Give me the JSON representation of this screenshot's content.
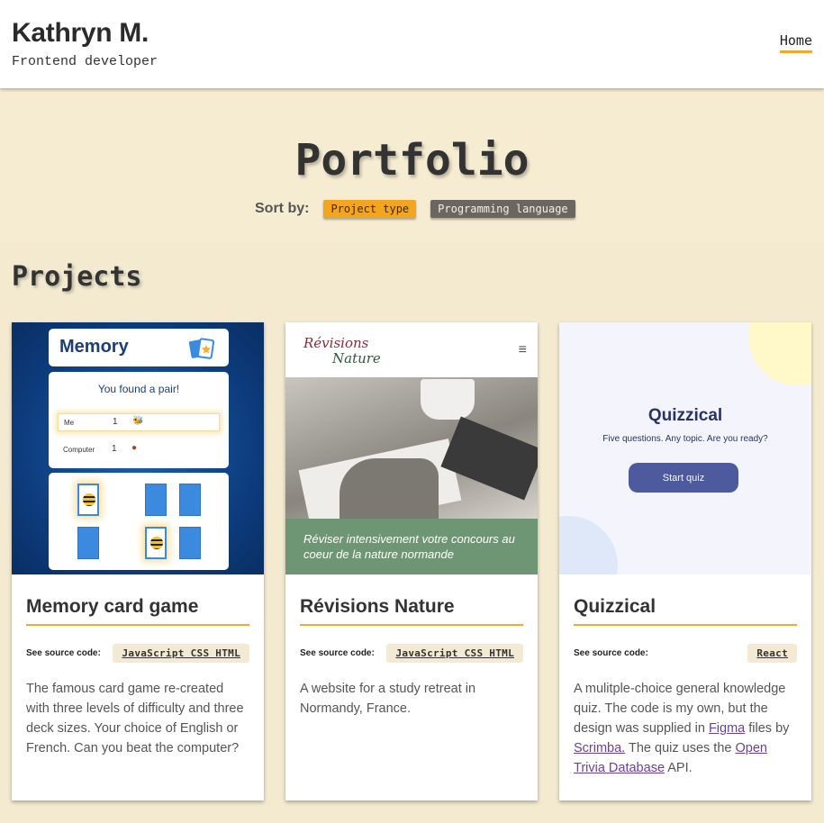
{
  "header": {
    "name": "Kathryn M.",
    "tagline": "Frontend developer",
    "nav_home": "Home"
  },
  "hero": {
    "title": "Portfolio",
    "sort_label": "Sort by:",
    "sort_options": [
      "Project type",
      "Programming language"
    ],
    "sort_active": "Project type"
  },
  "projects": {
    "heading": "Projects",
    "source_label": "See source code:",
    "cards": [
      {
        "title": "Memory card game",
        "tags": "JavaScript CSS HTML",
        "description": "The famous card game re-created with three levels of difficulty and three deck sizes. Your choice of English or French. Can you beat the computer?",
        "thumb": {
          "app_title": "Memory",
          "message": "You found a pair!",
          "player1": "Me",
          "player1_score": "1",
          "player2": "Computer",
          "player2_score": "1"
        }
      },
      {
        "title": "Révisions Nature",
        "tags": "JavaScript CSS HTML",
        "description": "A website for a study retreat in Normandy, France.",
        "thumb": {
          "logo_line1": "Révisions",
          "logo_line2": "Nature",
          "menu_icon": "≡",
          "banner": "Réviser intensivement votre concours au coeur de la nature normande"
        }
      },
      {
        "title": "Quizzical",
        "tags": "React",
        "description_pre": "A mulitple-choice general knowledge quiz. The code is my own, but the design was supplied in ",
        "link1": "Figma",
        "description_mid1": " files by ",
        "link2": "Scrimba.",
        "description_mid2": " The quiz uses the ",
        "link3": "Open Trivia Database",
        "description_post": " API.",
        "thumb": {
          "title": "Quizzical",
          "subtitle": "Five questions. Any topic. Are you ready?",
          "button": "Start quiz"
        }
      }
    ]
  },
  "colors": {
    "accent": "#f0a830",
    "background": "#f6ecd2",
    "link": "#6b3fa0"
  }
}
